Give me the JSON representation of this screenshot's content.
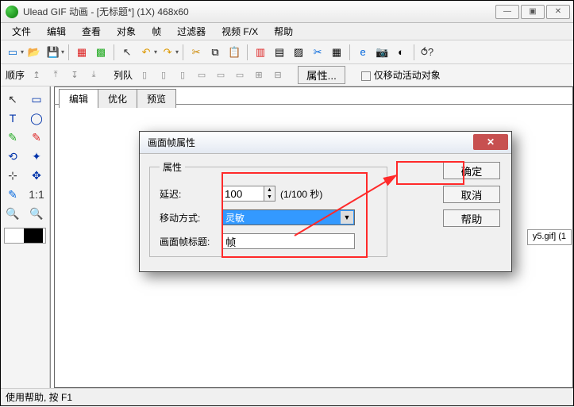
{
  "window": {
    "title": "Ulead GIF 动画 - [无标题*] (1X) 468x60",
    "min": "—",
    "max": "▣",
    "close": "✕"
  },
  "menu": [
    "文件",
    "编辑",
    "查看",
    "对象",
    "帧",
    "过滤器",
    "视频 F/X",
    "帮助"
  ],
  "toolbar2": {
    "order_label": "顺序",
    "queue_label": "列队",
    "props_btn": "属性...",
    "only_move_active": "仅移动活动对象"
  },
  "tabs": {
    "edit": "编辑",
    "opt": "优化",
    "preview": "预览"
  },
  "dialog": {
    "title": "画面帧属性",
    "legend": "属性",
    "delay_label": "延迟:",
    "delay_value": "100",
    "delay_unit": "(1/100 秒)",
    "move_label": "移动方式:",
    "move_value": "灵敏",
    "frame_title_label": "画面帧标题:",
    "frame_title_value": "帧",
    "ok": "确定",
    "cancel": "取消",
    "help": "帮助",
    "close_x": "✕"
  },
  "thumbnail_label": "y5.gif] (1",
  "status": "使用帮助, 按 F1"
}
